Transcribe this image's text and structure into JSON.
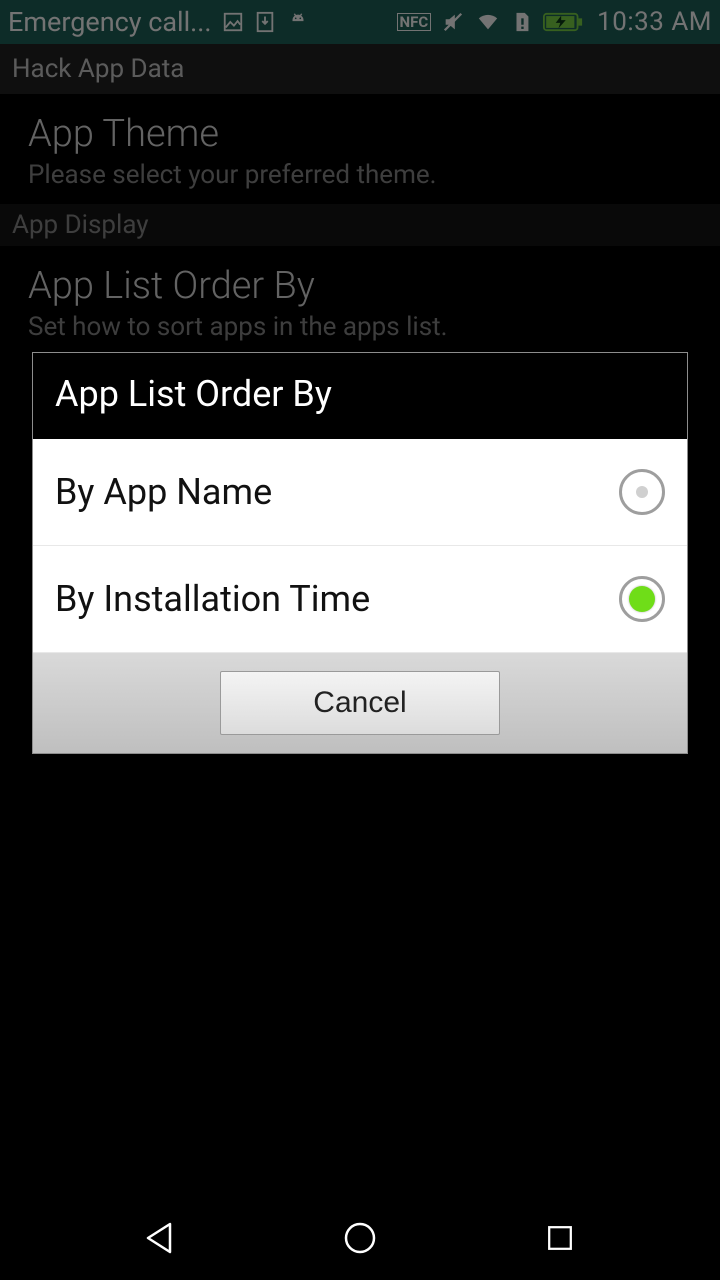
{
  "status_bar": {
    "notification_text": "Emergency call...",
    "time": "10:33 AM",
    "icons": {
      "image": "image-icon",
      "download": "download-icon",
      "android": "android-icon",
      "nfc": "NFC",
      "mute": "mute-icon",
      "wifi": "wifi-icon",
      "sim": "sim-icon",
      "battery": "battery-icon"
    }
  },
  "app_bar": {
    "title": "Hack App Data"
  },
  "settings": {
    "pref1": {
      "title": "App Theme",
      "summary": "Please select your preferred theme."
    },
    "section1": "App Display",
    "pref2": {
      "title": "App List Order By",
      "summary": "Set how to sort apps in the apps list."
    }
  },
  "dialog": {
    "title": "App List Order By",
    "options": [
      {
        "label": "By App Name",
        "selected": false
      },
      {
        "label": "By Installation Time",
        "selected": true
      }
    ],
    "cancel": "Cancel"
  }
}
